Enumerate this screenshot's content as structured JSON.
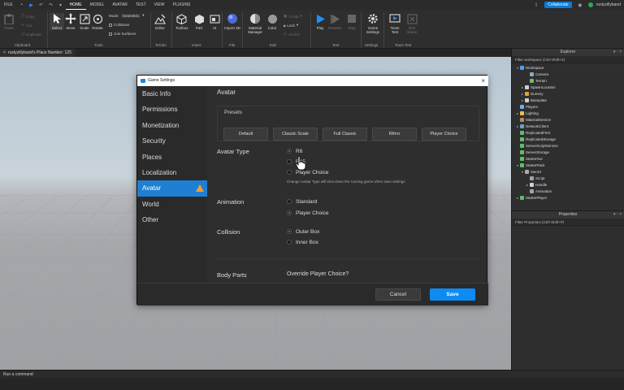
{
  "menubar": {
    "file": "FILE",
    "tabs": [
      "HOME",
      "MODEL",
      "AVATAR",
      "TEST",
      "VIEW",
      "PLUGINS"
    ],
    "active_tab": "HOME",
    "collaborate": "Collaborate",
    "username": "rustyzillyband"
  },
  "ribbon": {
    "clipboard": {
      "paste": "Paste",
      "copy": "Copy",
      "cut": "Cut",
      "duplicate": "Duplicate",
      "group": "Clipboard"
    },
    "tools": {
      "select": "Select",
      "move": "Move",
      "scale": "Scale",
      "rotate": "Rotate",
      "mode_label": "Mode:",
      "mode_value": "Geometric",
      "collisions": "Collisions",
      "join_surfaces": "Join Surfaces",
      "group": "Tools"
    },
    "terrain": {
      "editor": "Editor",
      "group": "Terrain"
    },
    "insert": {
      "toolbox": "Toolbox",
      "part": "Part",
      "ui": "UI",
      "group": "Insert"
    },
    "file": {
      "import3d": "Import 3D",
      "group": "File"
    },
    "edit": {
      "material_manager": "Material Manager",
      "color": "Color",
      "group_btn": "Group",
      "lock": "Lock",
      "anchor": "Anchor",
      "group": "Edit"
    },
    "test": {
      "play": "Play",
      "resume": "Resume",
      "stop": "Stop",
      "group": "Test"
    },
    "settings": {
      "game_settings": "Game Settings",
      "group": "Settings"
    },
    "team_test": {
      "team_test": "Team Test",
      "exit_game": "Exit Game",
      "group": "Team Test"
    }
  },
  "doc_tab": {
    "title": "rustyzillyband's Place Number: 125"
  },
  "command_bar": {
    "placeholder": "Run a command"
  },
  "explorer": {
    "title": "Explorer",
    "filter": "Filter workspace (Ctrl+Shift+X)",
    "items": [
      {
        "label": "Workspace",
        "indent": 0,
        "arrow": "▾",
        "color": "#4aa3ff"
      },
      {
        "label": "Camera",
        "indent": 2,
        "arrow": "",
        "color": "#8fa7c3"
      },
      {
        "label": "Terrain",
        "indent": 2,
        "arrow": "",
        "color": "#7db36b"
      },
      {
        "label": "SpawnLocation",
        "indent": 1,
        "arrow": "▸",
        "color": "#cfcfcf"
      },
      {
        "label": "Dummy",
        "indent": 1,
        "arrow": "▸",
        "color": "#d9a441"
      },
      {
        "label": "Baseplate",
        "indent": 1,
        "arrow": "▸",
        "color": "#cfcfcf"
      },
      {
        "label": "Players",
        "indent": 0,
        "arrow": "",
        "color": "#6fb0e6"
      },
      {
        "label": "Lighting",
        "indent": 0,
        "arrow": "▸",
        "color": "#e6c24f"
      },
      {
        "label": "MaterialService",
        "indent": 0,
        "arrow": "",
        "color": "#b88a5a"
      },
      {
        "label": "NetworkClient",
        "indent": 0,
        "arrow": "▸",
        "color": "#6c9dd1"
      },
      {
        "label": "ReplicatedFirst",
        "indent": 0,
        "arrow": "",
        "color": "#5fbf6b"
      },
      {
        "label": "ReplicatedStorage",
        "indent": 0,
        "arrow": "",
        "color": "#5fbf6b"
      },
      {
        "label": "ServerScriptService",
        "indent": 0,
        "arrow": "",
        "color": "#5fbf6b"
      },
      {
        "label": "ServerStorage",
        "indent": 0,
        "arrow": "",
        "color": "#5fbf6b"
      },
      {
        "label": "StarterGui",
        "indent": 0,
        "arrow": "",
        "color": "#5fbf6b"
      },
      {
        "label": "StarterPack",
        "indent": 0,
        "arrow": "▾",
        "color": "#5fbf6b"
      },
      {
        "label": "Sword",
        "indent": 1,
        "arrow": "▾",
        "color": "#aaaaaa"
      },
      {
        "label": "Script",
        "indent": 2,
        "arrow": "",
        "color": "#9aa6b2"
      },
      {
        "label": "Handle",
        "indent": 2,
        "arrow": "▸",
        "color": "#cfcfcf"
      },
      {
        "label": "Animation",
        "indent": 2,
        "arrow": "",
        "color": "#9aa6b2"
      },
      {
        "label": "StarterPlayer",
        "indent": 0,
        "arrow": "▸",
        "color": "#5fbf6b"
      }
    ]
  },
  "properties": {
    "title": "Properties",
    "filter": "Filter Properties (Ctrl+Shift+P)"
  },
  "dialog": {
    "title": "Game Settings",
    "sidebar": [
      {
        "label": "Basic Info"
      },
      {
        "label": "Permissions"
      },
      {
        "label": "Monetization"
      },
      {
        "label": "Security"
      },
      {
        "label": "Places"
      },
      {
        "label": "Localization"
      },
      {
        "label": "Avatar",
        "active": true,
        "warning": true
      },
      {
        "label": "World"
      },
      {
        "label": "Other"
      }
    ],
    "main": {
      "header": "Avatar",
      "presets_label": "Presets",
      "presets": [
        "Default",
        "Classic Scale",
        "Full Classic",
        "Rthro",
        "Player Choice"
      ],
      "avatar_type": {
        "label": "Avatar Type",
        "options": [
          "R6",
          "R15",
          "Player Choice"
        ],
        "selected": "R6",
        "note": "Change Avatar Type will shut down the running game when save settings"
      },
      "animation": {
        "label": "Animation",
        "options": [
          "Standard",
          "Player Choice"
        ],
        "selected": "Player Choice"
      },
      "collision": {
        "label": "Collision",
        "options": [
          "Outer Box",
          "Inner Box"
        ],
        "selected": "Outer Box"
      },
      "body_parts": {
        "label": "Body Parts",
        "value": "Override Player Choice?"
      }
    },
    "cancel": "Cancel",
    "save": "Save"
  }
}
